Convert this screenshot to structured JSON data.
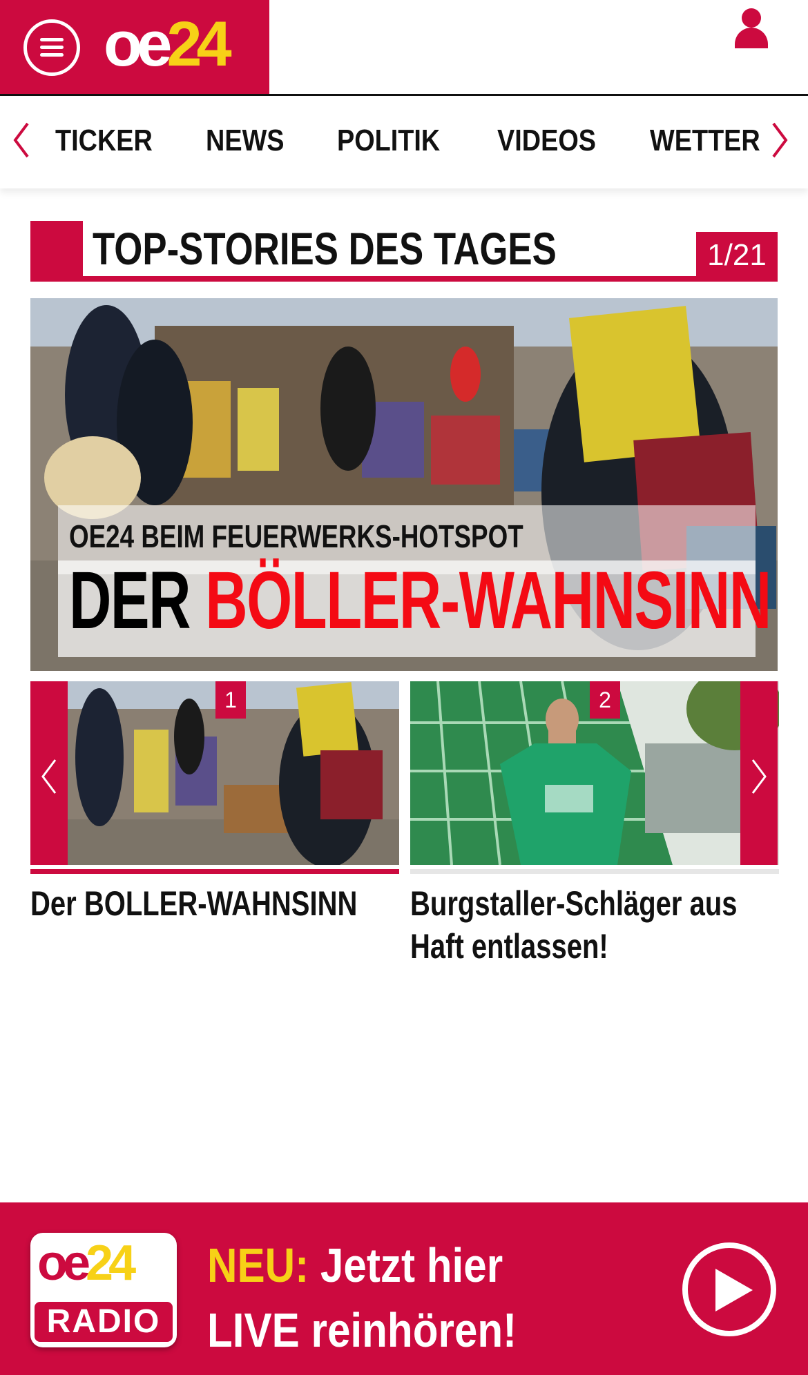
{
  "header": {
    "logo": {
      "oe": "oe",
      "num": "24"
    },
    "menu_icon": "hamburger-menu-icon",
    "user_icon": "user-icon",
    "brand_color": "#cc0a3f",
    "accent_color": "#f7d117"
  },
  "nav": {
    "items": [
      "TICKER",
      "NEWS",
      "POLITIK",
      "VIDEOS",
      "WETTER"
    ],
    "prev_icon": "chevron-left-icon",
    "next_icon": "chevron-right-icon"
  },
  "section": {
    "title": "TOP-STORIES DES TAGES",
    "counter": "1/21"
  },
  "hero": {
    "kicker": "OE24 BEIM FEUERWERKS-HOTSPOT",
    "headline_black": "DER",
    "headline_red": "BÖLLER-WAHNSINN",
    "headline_red_color": "#f40a14"
  },
  "cards": [
    {
      "number": "1",
      "title": "Der BOLLER-WAHNSINN"
    },
    {
      "number": "2",
      "title": "Burgstaller-Schläger aus Haft entlassen!"
    }
  ],
  "radio_banner": {
    "logo_top_oe": "oe",
    "logo_top_num": "24",
    "logo_bottom": "RADIO",
    "neu": "NEU:",
    "line1_rest": " Jetzt hier",
    "line2": "LIVE reinhören!",
    "play_icon": "play-icon"
  }
}
